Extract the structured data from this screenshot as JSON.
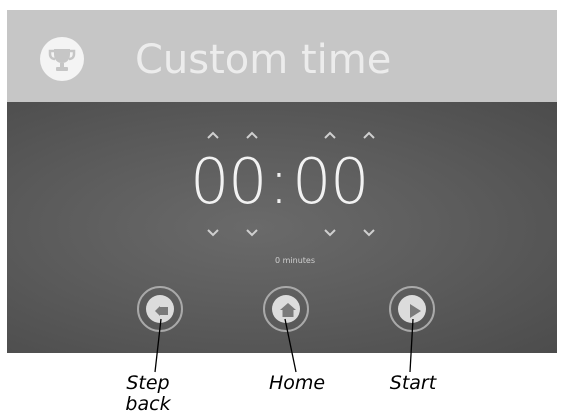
{
  "header": {
    "title": "Custom time",
    "icon": "trophy-icon"
  },
  "timer": {
    "digits": [
      "0",
      "0",
      "0",
      "0"
    ],
    "separator": ":",
    "duration_text": "0 minutes"
  },
  "controls": [
    {
      "name": "step-back-button",
      "icon": "step-back-icon"
    },
    {
      "name": "home-button",
      "icon": "home-icon"
    },
    {
      "name": "start-button",
      "icon": "play-icon"
    }
  ],
  "callouts": {
    "step_back": "Step\nback",
    "home": "Home",
    "start": "Start"
  },
  "colors": {
    "header_bg": "#c6c6c6",
    "header_text": "#ececec",
    "panel_bg": "#5a5a5a",
    "display_text": "#f2f2f2"
  }
}
